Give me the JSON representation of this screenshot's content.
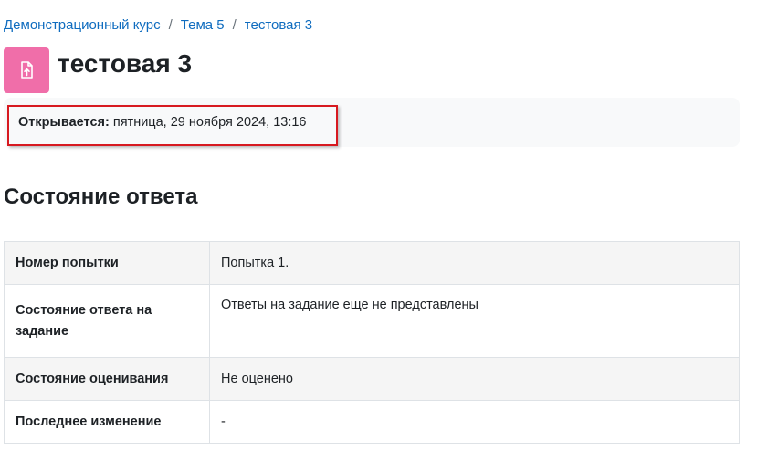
{
  "breadcrumb": {
    "items": [
      "Демонстрационный курс",
      "Тема 5",
      "тестовая 3"
    ],
    "separator": "/"
  },
  "activity": {
    "icon": "assignment-upload-icon",
    "icon_color": "#f06ea9",
    "title": "тестовая 3"
  },
  "dates": {
    "opens_label": "Открывается:",
    "opens_value": "пятница, 29 ноября 2024, 13:16"
  },
  "submission_status": {
    "heading": "Состояние ответа",
    "rows": [
      {
        "label": "Номер попытки",
        "value": "Попытка 1."
      },
      {
        "label": "Состояние ответа на задание",
        "value": "Ответы на задание еще не представлены"
      },
      {
        "label": "Состояние оценивания",
        "value": "Не оценено"
      },
      {
        "label": "Последнее изменение",
        "value": "-"
      }
    ]
  },
  "colors": {
    "link": "#0f6cbf",
    "highlight_border": "#d71920"
  }
}
